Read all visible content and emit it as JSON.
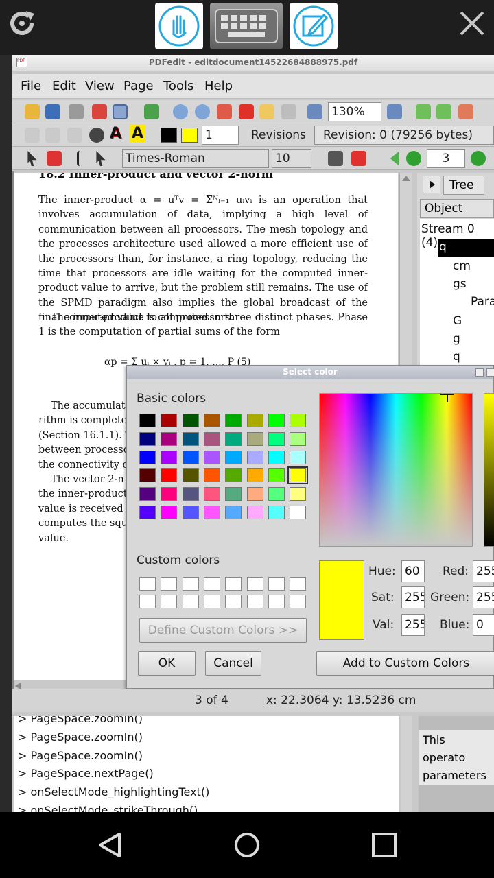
{
  "window": {
    "title": "PDFedit - editdocument14522684888975.pdf"
  },
  "menu": [
    "File",
    "Edit",
    "View",
    "Page",
    "Tools",
    "Help"
  ],
  "toolbar": {
    "zoom": "130%",
    "line_width": "1",
    "revisions_label": "Revisions",
    "revision_value": "Revision: 0 (79256 bytes)",
    "font_name": "Times-Roman",
    "font_size": "10",
    "page_number": "3"
  },
  "side_panel": {
    "tab_tree": "Tree",
    "object_header": "Object",
    "stream_label": "Stream 0 (4)",
    "items": [
      "q",
      "cm",
      "gs",
      "Para",
      "G",
      "g",
      "q"
    ]
  },
  "document": {
    "heading": "18.2    Inner-product and vector 2-norm",
    "para1": "The inner-product α = uᵀv = Σᴺᵢ₌₁ uᵢvᵢ is an operation that involves accumulation of data, implying a high level of communication between all processors. The mesh topology and the processes architecture used allowed a more efficient use of the processors than, for instance, a ring topology, reducing the time that processors are idle waiting for the computed inner-product value to arrive, but the problem still remains. The use of the SPMD paradigm also implies the global broadcast of the final computed value to all processors.",
    "para2": "The inner-product is computed in three distinct phases. Phase 1 is the computation of partial sums of the form",
    "formula": "αp = Σ uᵢ × vᵢ ,    p = 1, ..., P          (5)",
    "para3_lines": [
      "The accumulati",
      "rithm is completed",
      "(Section 16.1.1). T",
      "between processor",
      "the connectivity of"
    ],
    "para4_lines": [
      "The vector 2-n",
      "the inner-product a",
      "value is received b",
      "computes the squa",
      "value."
    ]
  },
  "dialog": {
    "title": "Select color",
    "basic_colors_label": "Basic colors",
    "custom_colors_label": "Custom colors",
    "define_button": "Define Custom Colors >>",
    "ok_button": "OK",
    "cancel_button": "Cancel",
    "add_button": "Add to Custom Colors",
    "hue_label": "Hue:",
    "sat_label": "Sat:",
    "val_label": "Val:",
    "red_label": "Red:",
    "green_label": "Green:",
    "blue_label": "Blue:",
    "hue": "60",
    "sat": "255",
    "val": "255",
    "red": "255",
    "green": "255",
    "blue": "0",
    "selected_color": "#ffff00",
    "basic_colors": [
      [
        "#000000",
        "#aa0000",
        "#005500",
        "#aa5500",
        "#00aa00",
        "#aaaa00",
        "#00ff00",
        "#aaff00"
      ],
      [
        "#00007f",
        "#aa007f",
        "#00557f",
        "#aa557f",
        "#00aa7f",
        "#aaaa7f",
        "#00ff7f",
        "#aaff7f"
      ],
      [
        "#0000ff",
        "#aa00ff",
        "#0055ff",
        "#aa55ff",
        "#00aaff",
        "#aaaaff",
        "#00ffff",
        "#aaffff"
      ],
      [
        "#550000",
        "#ff0000",
        "#555500",
        "#ff5500",
        "#55aa00",
        "#ffaa00",
        "#55ff00",
        "#ffff00"
      ],
      [
        "#55007f",
        "#ff007f",
        "#55557f",
        "#ff557f",
        "#55aa7f",
        "#ffaa7f",
        "#55ff7f",
        "#ffff7f"
      ],
      [
        "#5500ff",
        "#ff00ff",
        "#5555ff",
        "#ff55ff",
        "#55aaff",
        "#ffaaff",
        "#55ffff",
        "#ffffff"
      ]
    ]
  },
  "status": {
    "page": "3 of 4",
    "coords": "x: 22.3064 y: 13.5236 cm"
  },
  "console": [
    "> PageSpace.zoomIn()",
    "> PageSpace.zoomIn()",
    "> PageSpace.zoomIn()",
    "> PageSpace.nextPage()",
    "> onSelectMode_highlightingText()",
    "> onSelectMode_strikeThrough()"
  ],
  "help_text": "This operato parameters"
}
